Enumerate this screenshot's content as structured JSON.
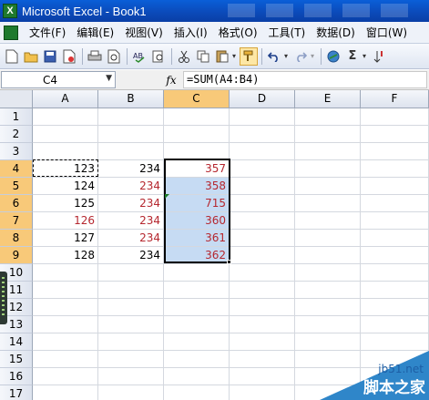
{
  "window": {
    "title": "Microsoft Excel - Book1",
    "app_icon_glyph": "X"
  },
  "menu": [
    "文件(F)",
    "编辑(E)",
    "视图(V)",
    "插入(I)",
    "格式(O)",
    "工具(T)",
    "数据(D)",
    "窗口(W)"
  ],
  "toolbar": {
    "icons": [
      "new-icon",
      "open-icon",
      "save-icon",
      "permission-icon",
      "print-icon",
      "print-preview-icon",
      "spelling-icon",
      "research-icon",
      "cut-icon",
      "copy-icon",
      "paste-icon",
      "format-painter-icon",
      "undo-icon",
      "redo-icon",
      "hyperlink-icon",
      "autosum-icon",
      "sort-icon"
    ],
    "autosum_glyph": "Σ"
  },
  "formula_bar": {
    "name_box": "C4",
    "fx_label": "fx",
    "formula": "=SUM(A4:B4)"
  },
  "grid": {
    "columns": [
      "A",
      "B",
      "C",
      "D",
      "E",
      "F"
    ],
    "rows": [
      "1",
      "2",
      "3",
      "4",
      "5",
      "6",
      "7",
      "8",
      "9",
      "10",
      "11",
      "12",
      "13",
      "14",
      "15",
      "16",
      "17"
    ],
    "selected_column": "C",
    "selected_rows": [
      "4",
      "5",
      "6",
      "7",
      "8",
      "9"
    ],
    "cells": {
      "A4": "123",
      "B4": "234",
      "C4": "357",
      "A5": "124",
      "B5": "234",
      "C5": "358",
      "A6": "125",
      "B6": "234",
      "C6": "715",
      "A7": "126",
      "B7": "234",
      "C7": "360",
      "A8": "127",
      "B8": "234",
      "C8": "361",
      "A9": "128",
      "B9": "234",
      "C9": "362"
    }
  },
  "watermark": {
    "url": "jb51.net",
    "cn": "脚本之家"
  },
  "colors": {
    "title_bar": "#0b49b8",
    "selection_fill": "#c6dbf3",
    "header_highlight": "#f8c979",
    "red_text": "#b5272f"
  }
}
